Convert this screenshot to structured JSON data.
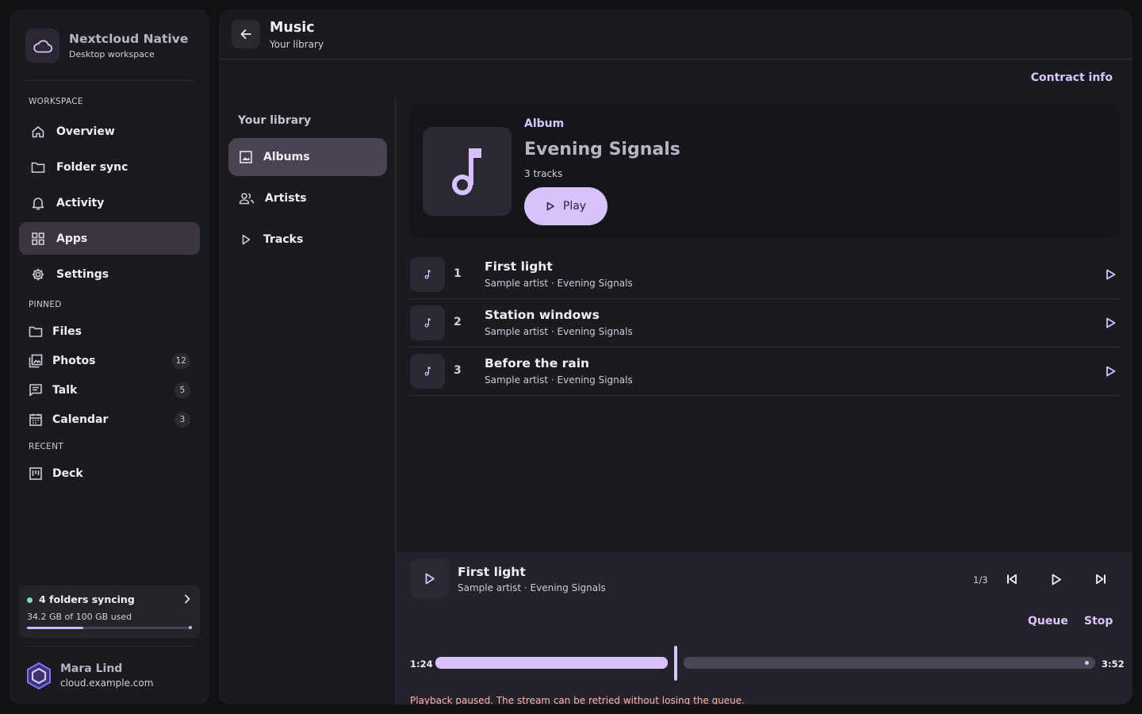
{
  "sidebar": {
    "brand_title": "Nextcloud Native",
    "brand_subtitle": "Desktop workspace",
    "workspace_label": "WORKSPACE",
    "workspace_items": [
      {
        "label": "Overview",
        "icon": "home-icon"
      },
      {
        "label": "Folder sync",
        "icon": "folder-icon"
      },
      {
        "label": "Activity",
        "icon": "bell-icon"
      },
      {
        "label": "Apps",
        "icon": "apps-grid-icon",
        "active": true
      },
      {
        "label": "Settings",
        "icon": "gear-icon"
      }
    ],
    "pinned_label": "PINNED",
    "pinned_items": [
      {
        "label": "Files",
        "icon": "folder-icon",
        "badge": ""
      },
      {
        "label": "Photos",
        "icon": "photos-icon",
        "badge": "12"
      },
      {
        "label": "Talk",
        "icon": "chat-icon",
        "badge": "5"
      },
      {
        "label": "Calendar",
        "icon": "calendar-icon",
        "badge": "3"
      }
    ],
    "recent_label": "RECENT",
    "recent_items": [
      {
        "label": "Deck",
        "icon": "deck-icon"
      }
    ],
    "sync": {
      "title": "4 folders syncing",
      "usage": "34.2 GB of 100 GB used",
      "used_fraction": 0.342,
      "status_color": "#7fd9c4"
    },
    "user": {
      "name": "Mara Lind",
      "host": "cloud.example.com"
    }
  },
  "header": {
    "title": "Music",
    "subtitle": "Your library",
    "contract_link": "Contract info"
  },
  "library": {
    "heading": "Your library",
    "items": [
      {
        "label": "Albums",
        "icon": "image-icon",
        "active": true
      },
      {
        "label": "Artists",
        "icon": "people-icon"
      },
      {
        "label": "Tracks",
        "icon": "play-outline-icon"
      }
    ]
  },
  "album": {
    "kind": "Album",
    "title": "Evening Signals",
    "track_count": "3 tracks",
    "play_label": "Play"
  },
  "tracks": [
    {
      "number": "1",
      "title": "First light",
      "meta": "Sample artist · Evening Signals"
    },
    {
      "number": "2",
      "title": "Station windows",
      "meta": "Sample artist · Evening Signals"
    },
    {
      "number": "3",
      "title": "Before the rain",
      "meta": "Sample artist · Evening Signals"
    }
  ],
  "player": {
    "title": "First light",
    "meta": "Sample artist · Evening Signals",
    "queue_position": "1/3",
    "queue_label": "Queue",
    "stop_label": "Stop",
    "elapsed": "1:24",
    "duration": "3:52",
    "progress_fraction": 0.362,
    "status_message": "Playback paused. The stream can be retried without losing the queue."
  },
  "colors": {
    "accent": "#d7c2fc",
    "accent_text": "#d9c5ff",
    "error_text": "#ffb4ab",
    "active_nav": "#3b3542"
  }
}
